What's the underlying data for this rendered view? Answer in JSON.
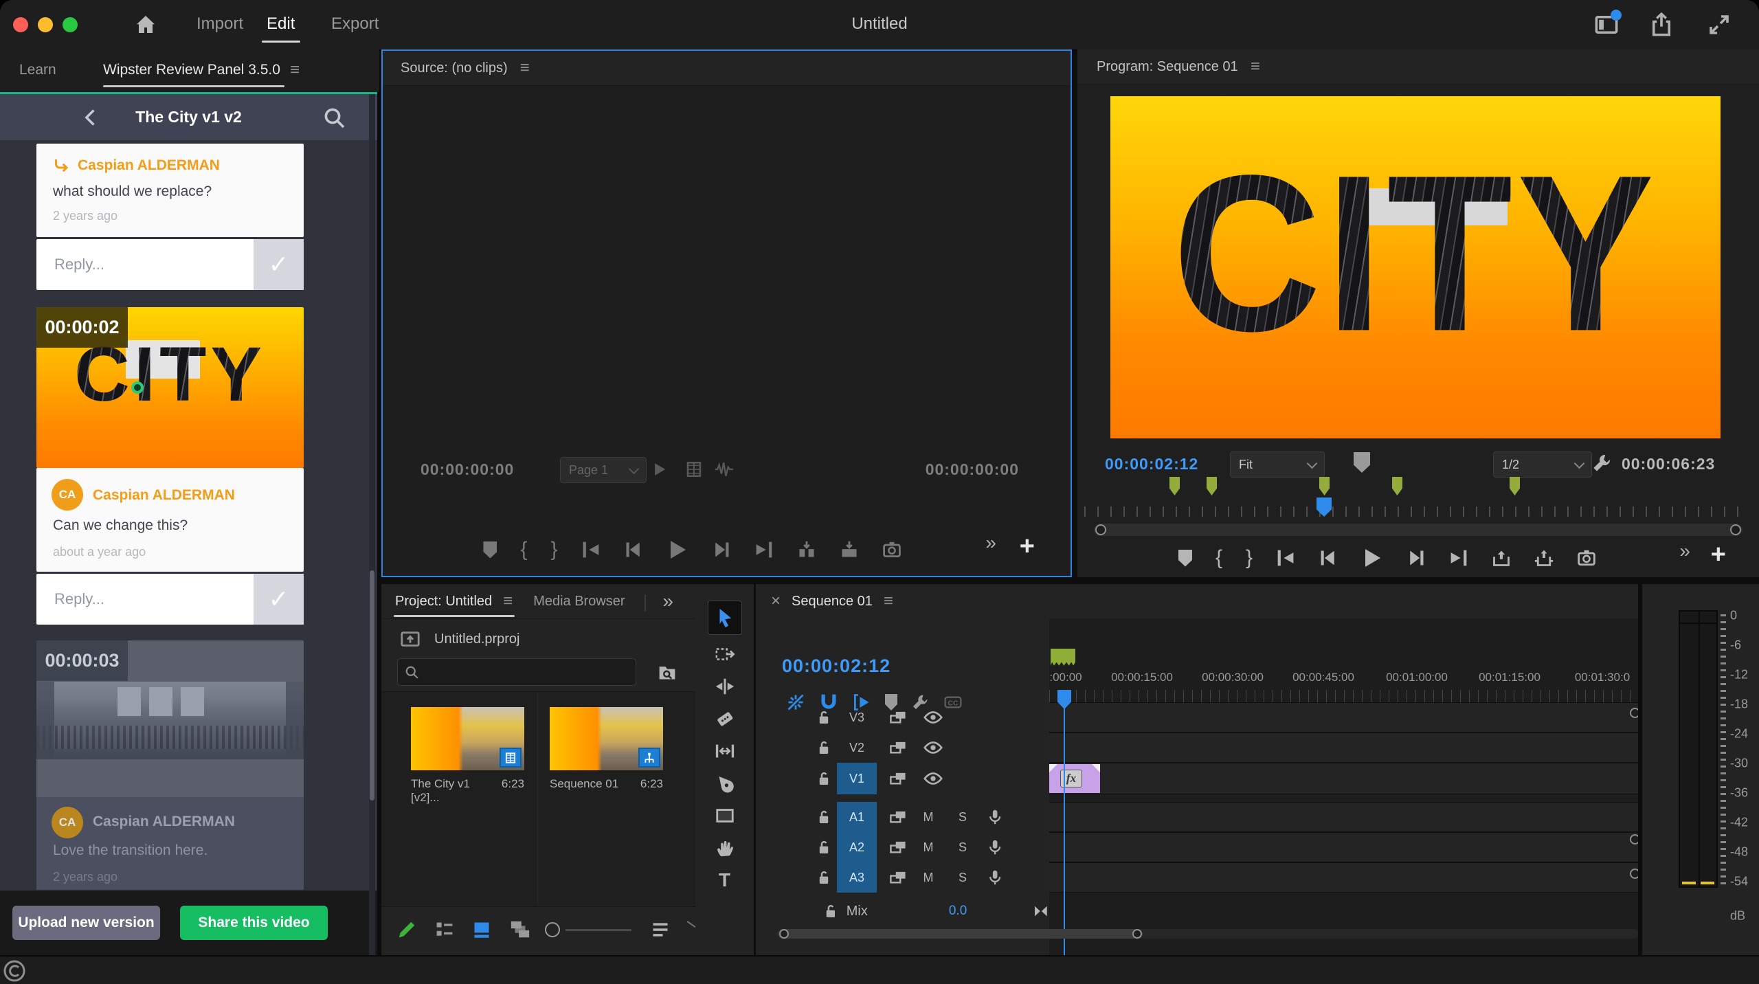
{
  "glyphs": {
    "menu": "≡",
    "more": "»",
    "close": "×",
    "plus": "+",
    "brace_open": "{",
    "brace_close": "}",
    "check": "✓",
    "divider": "|"
  },
  "titlebar": {
    "title": "Untitled",
    "menu": [
      {
        "label": "Import"
      },
      {
        "label": "Edit"
      },
      {
        "label": "Export"
      }
    ]
  },
  "left_tabs": {
    "learn": "Learn",
    "wipster": "Wipster Review Panel 3.5.0"
  },
  "wipster": {
    "header_title": "The City v1 v2",
    "reply_placeholder": "Reply...",
    "comment1": {
      "author": "Caspian ALDERMAN",
      "text": "what should we replace?",
      "time": "2 years ago"
    },
    "comment2": {
      "badge": "00:00:02",
      "avatar": "CA",
      "author": "Caspian ALDERMAN",
      "text": "Can we change this?",
      "time": "about a year ago",
      "thumb_text": "CITY"
    },
    "comment3": {
      "badge": "00:00:03",
      "avatar": "CA",
      "author": "Caspian ALDERMAN",
      "text": "Love the transition here.",
      "time": "2 years ago"
    },
    "upload_button": "Upload new version",
    "share_button": "Share this video",
    "accent_green": "#1db583",
    "accent_orange": "#f49d17"
  },
  "source": {
    "title": "Source: (no clips)",
    "tc_in": "00:00:00:00",
    "page_select": "Page 1",
    "tc_out": "00:00:00:00"
  },
  "program": {
    "title": "Program: Sequence 01",
    "tc_current": "00:00:02:12",
    "fit_select": "Fit",
    "zoom_select": "1/2",
    "tc_duration": "00:00:06:23",
    "monitor_text": "CITY"
  },
  "project": {
    "tab": "Project: Untitled",
    "tab_media": "Media Browser",
    "file_name": "Untitled.prproj",
    "items": [
      {
        "name": "The City v1 [v2]...",
        "duration": "6:23"
      },
      {
        "name": "Sequence 01",
        "duration": "6:23"
      }
    ]
  },
  "tools": {
    "type_label": "T"
  },
  "timeline": {
    "tab": "Sequence 01",
    "tc": "00:00:02:12",
    "ruler": [
      ":00:00",
      "00:00:15:00",
      "00:00:30:00",
      "00:00:45:00",
      "00:01:00:00",
      "00:01:15:00",
      "00:01:30:0"
    ],
    "video_tracks": [
      "V3",
      "V2",
      "V1"
    ],
    "audio_tracks": [
      "A1",
      "A2",
      "A3"
    ],
    "mute": "M",
    "solo": "S",
    "mix_label": "Mix",
    "mix_value": "0.0",
    "clip_fx": "fx",
    "playhead_color": "#2f8ceb",
    "marker_green": "#93ac3c"
  },
  "meters": {
    "scale": [
      "0",
      "-6",
      "-12",
      "-18",
      "-24",
      "-30",
      "-36",
      "-42",
      "-48",
      "-54"
    ],
    "unit": "dB"
  }
}
